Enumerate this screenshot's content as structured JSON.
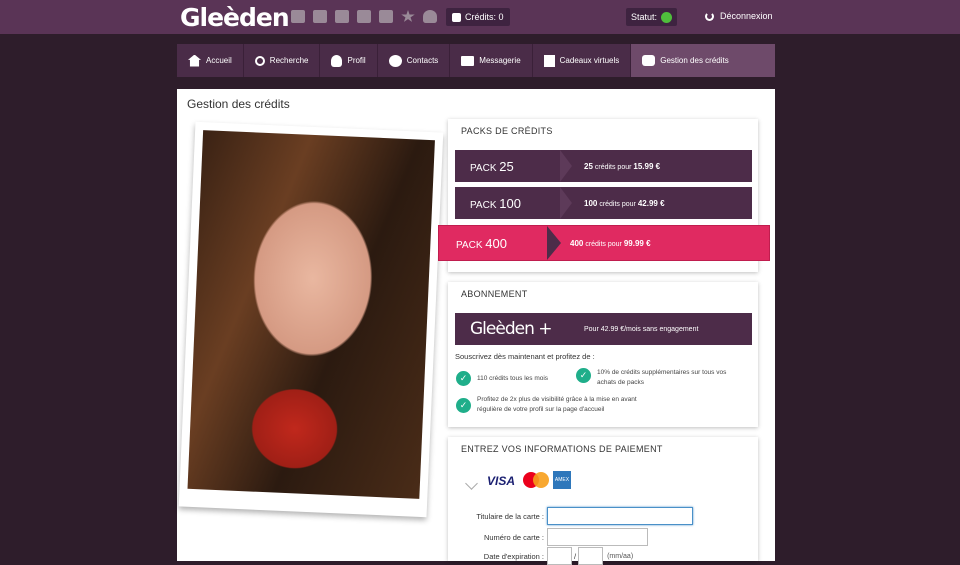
{
  "header": {
    "logo": "Gleèden",
    "credits_label": "Crédits: 0",
    "status_label": "Statut:",
    "logout_label": "Déconnexion",
    "status_color": "#4fbe3c"
  },
  "top_icons": [
    "envelope-icon",
    "photo-icon",
    "camera-icon",
    "gift-icon",
    "chat-icon",
    "star-icon",
    "heart-icon"
  ],
  "nav": {
    "items": [
      {
        "label": "Accueil",
        "icon": "home-icon"
      },
      {
        "label": "Recherche",
        "icon": "search-icon"
      },
      {
        "label": "Profil",
        "icon": "profile-icon"
      },
      {
        "label": "Contacts",
        "icon": "globe-icon"
      },
      {
        "label": "Messagerie",
        "icon": "envelope-icon"
      },
      {
        "label": "Cadeaux virtuels",
        "icon": "gift-icon"
      },
      {
        "label": "Gestion des crédits",
        "icon": "coins-icon"
      }
    ],
    "active_index": 6
  },
  "page": {
    "title": "Gestion des crédits"
  },
  "packs": {
    "title": "Packs de crédits",
    "items": [
      {
        "prefix": "Pack",
        "number": "25",
        "credits": "25",
        "middle": "crédits pour",
        "price": "15.99 €"
      },
      {
        "prefix": "Pack",
        "number": "100",
        "credits": "100",
        "middle": "crédits pour",
        "price": "42.99 €"
      },
      {
        "prefix": "Pack",
        "number": "400",
        "credits": "400",
        "middle": "crédits pour",
        "price": "99.99 €"
      }
    ],
    "highlight_color": "#e02a61",
    "base_color": "#4d2c49"
  },
  "subscription": {
    "title": "Abonnement",
    "logo": "Gleèden +",
    "offer": "Pour 42.99 €/mois sans engagement",
    "intro": "Souscrivez dès maintenant et profitez de :",
    "benefits": [
      "110 crédits tous les mois",
      "10% de crédits supplémentaires sur tous vos achats de packs",
      "Profitez de 2x plus de visibilité grâce à la mise en avant régulière de votre profil sur la page d'accueil"
    ]
  },
  "payment": {
    "title": "Entrez vos informations de paiement",
    "card_brands": [
      "VISA",
      "Mastercard",
      "American Express"
    ],
    "holder_label": "Titulaire de la carte :",
    "number_label": "Numéro de carte :",
    "expiry_label": "Date d'expiration :",
    "expiry_separator": "/",
    "expiry_hint": "(mm/aa)"
  }
}
